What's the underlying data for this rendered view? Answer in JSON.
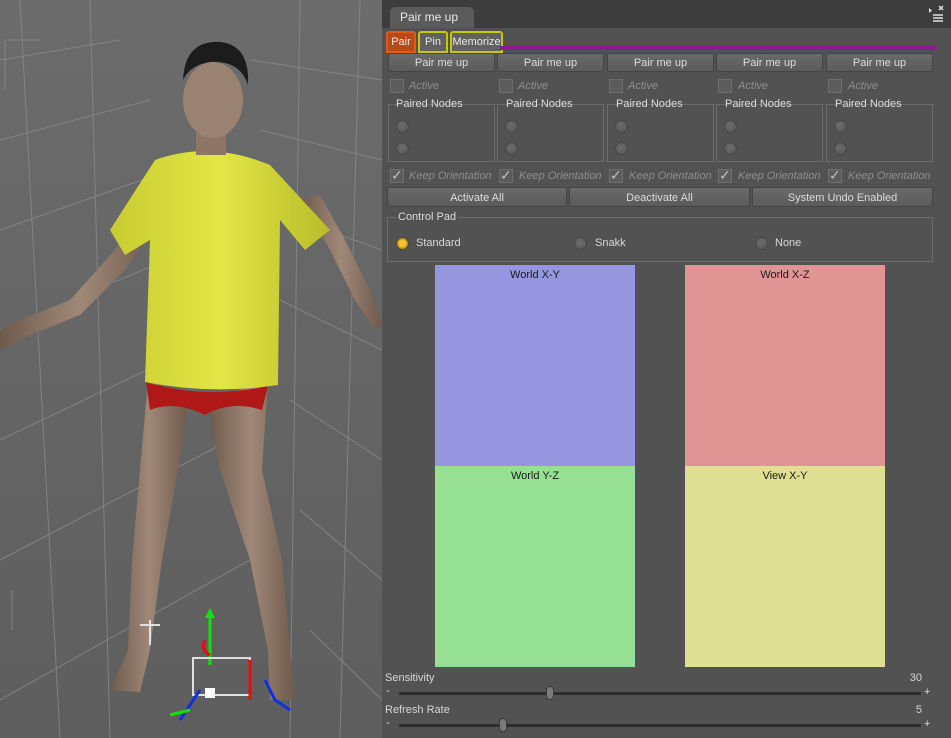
{
  "viewport": {
    "description_icons": [
      "figure",
      "universal-manipulator-icon",
      "ground-grid"
    ]
  },
  "pane": {
    "title": "Pair me up"
  },
  "subtabs": [
    {
      "label": "Pair",
      "border": "#e05a1a",
      "bg": "#b84a18"
    },
    {
      "label": "Pin",
      "border": "#c8c800",
      "bg": "#616161"
    },
    {
      "label": "Memorize",
      "border": "#c8c800",
      "bg": "#616161"
    }
  ],
  "columns": [
    {
      "button": "Pair me up",
      "active": "Active",
      "group": "Paired Nodes",
      "keep": "Keep Orientation"
    },
    {
      "button": "Pair me up",
      "active": "Active",
      "group": "Paired Nodes",
      "keep": "Keep Orientation"
    },
    {
      "button": "Pair me up",
      "active": "Active",
      "group": "Paired Nodes",
      "keep": "Keep Orientation"
    },
    {
      "button": "Pair me up",
      "active": "Active",
      "group": "Paired Nodes",
      "keep": "Keep Orientation"
    },
    {
      "button": "Pair me up",
      "active": "Active",
      "group": "Paired Nodes",
      "keep": "Keep Orientation"
    }
  ],
  "actions": {
    "activate": "Activate All",
    "deactivate": "Deactivate All",
    "undo": "System Undo Enabled"
  },
  "control_pad": {
    "title": "Control Pad",
    "options": [
      "Standard",
      "Snakk",
      "None"
    ],
    "selected": "Standard"
  },
  "pads": [
    {
      "label": "World X-Y",
      "color": "#9696e0"
    },
    {
      "label": "World X-Z",
      "color": "#e09494"
    },
    {
      "label": "World Y-Z",
      "color": "#96e094"
    },
    {
      "label": "View X-Y",
      "color": "#e0e094"
    }
  ],
  "sliders": {
    "sensitivity": {
      "label": "Sensitivity",
      "value": "30",
      "fraction": 0.29
    },
    "refresh": {
      "label": "Refresh Rate",
      "value": "5",
      "fraction": 0.2
    },
    "minus": "-",
    "plus": "+"
  }
}
